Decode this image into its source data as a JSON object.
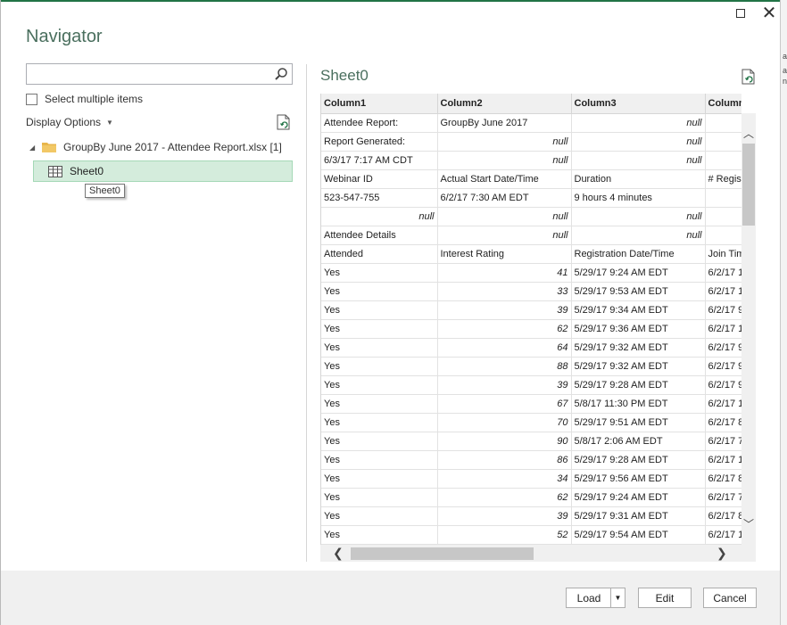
{
  "window": {
    "title": "Navigator",
    "strip_chars": [
      "a",
      "a",
      "n"
    ]
  },
  "left_panel": {
    "search_placeholder": "",
    "search_value": "",
    "select_multiple_label": "Select multiple items",
    "display_options_label": "Display Options",
    "tree": {
      "folder_label": "GroupBy June 2017 - Attendee Report.xlsx [1]",
      "sheet_label": "Sheet0",
      "tooltip": "Sheet0"
    }
  },
  "preview": {
    "title": "Sheet0",
    "columns": [
      "Column1",
      "Column2",
      "Column3",
      "Column4"
    ],
    "rows": [
      [
        "Attendee Report:",
        "GroupBy June 2017",
        "null",
        ""
      ],
      [
        "Report Generated:",
        "null",
        "null",
        ""
      ],
      [
        "6/3/17 7:17 AM CDT",
        "null",
        "null",
        ""
      ],
      [
        "Webinar ID",
        "Actual Start Date/Time",
        "Duration",
        "# Regist"
      ],
      [
        "523-547-755",
        "6/2/17 7:30 AM EDT",
        "9 hours 4 minutes",
        ""
      ],
      [
        "null",
        "null",
        "null",
        ""
      ],
      [
        "Attendee Details",
        "null",
        "null",
        ""
      ],
      [
        "Attended",
        "Interest Rating",
        "Registration Date/Time",
        "Join Tim"
      ],
      [
        "Yes",
        "41",
        "5/29/17 9:24 AM EDT",
        "6/2/17 1"
      ],
      [
        "Yes",
        "33",
        "5/29/17 9:53 AM EDT",
        "6/2/17 1"
      ],
      [
        "Yes",
        "39",
        "5/29/17 9:34 AM EDT",
        "6/2/17 9"
      ],
      [
        "Yes",
        "62",
        "5/29/17 9:36 AM EDT",
        "6/2/17 1"
      ],
      [
        "Yes",
        "64",
        "5/29/17 9:32 AM EDT",
        "6/2/17 9"
      ],
      [
        "Yes",
        "88",
        "5/29/17 9:32 AM EDT",
        "6/2/17 9"
      ],
      [
        "Yes",
        "39",
        "5/29/17 9:28 AM EDT",
        "6/2/17 9"
      ],
      [
        "Yes",
        "67",
        "5/8/17 11:30 PM EDT",
        "6/2/17 1"
      ],
      [
        "Yes",
        "70",
        "5/29/17 9:51 AM EDT",
        "6/2/17 8"
      ],
      [
        "Yes",
        "90",
        "5/8/17 2:06 AM EDT",
        "6/2/17 7"
      ],
      [
        "Yes",
        "86",
        "5/29/17 9:28 AM EDT",
        "6/2/17 1"
      ],
      [
        "Yes",
        "34",
        "5/29/17 9:56 AM EDT",
        "6/2/17 8"
      ],
      [
        "Yes",
        "62",
        "5/29/17 9:24 AM EDT",
        "6/2/17 7"
      ],
      [
        "Yes",
        "39",
        "5/29/17 9:31 AM EDT",
        "6/2/17 8"
      ],
      [
        "Yes",
        "52",
        "5/29/17 9:54 AM EDT",
        "6/2/17 1"
      ]
    ]
  },
  "footer": {
    "load_label": "Load",
    "edit_label": "Edit",
    "cancel_label": "Cancel"
  },
  "colors": {
    "accent": "#217346",
    "title_text": "#4a6f5e",
    "selection_bg": "#d4ecdc"
  },
  "icons": [
    "close-icon",
    "maximize-icon",
    "search-icon",
    "document-refresh-icon",
    "folder-icon",
    "table-icon",
    "chevron-down-icon"
  ]
}
